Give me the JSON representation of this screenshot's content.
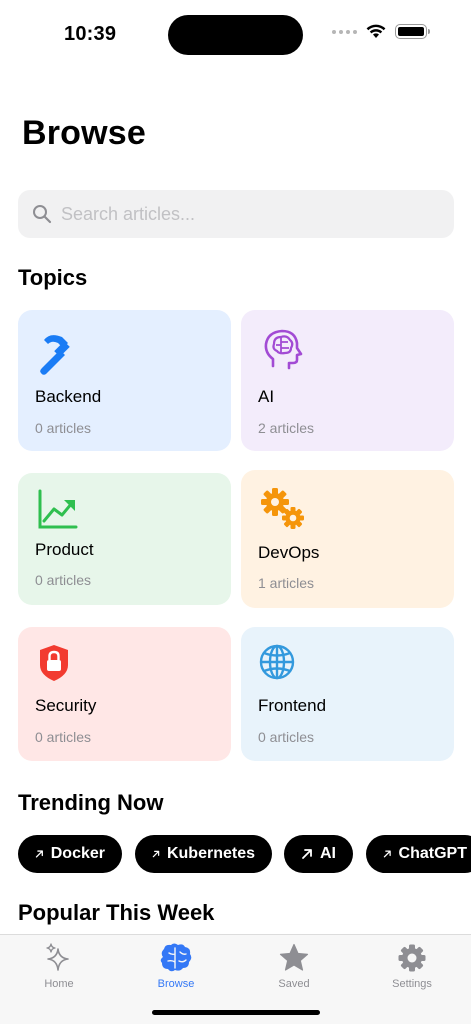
{
  "status_bar": {
    "time": "10:39"
  },
  "header": {
    "title": "Browse"
  },
  "search": {
    "placeholder": "Search articles..."
  },
  "topics": {
    "title": "Topics",
    "items": [
      {
        "name": "Backend",
        "count": "0 articles",
        "icon": "hammer-icon",
        "color": "#e4efff",
        "icon_color": "#1a7cf5"
      },
      {
        "name": "AI",
        "count": "2 articles",
        "icon": "brain-head-icon",
        "color": "#f3ecfb",
        "icon_color": "#a24bd4"
      },
      {
        "name": "Product",
        "count": "0 articles",
        "icon": "chart-line-uptrend-icon",
        "color": "#e7f6ea",
        "icon_color": "#2fbf4f"
      },
      {
        "name": "DevOps",
        "count": "1 articles",
        "icon": "gears-icon",
        "color": "#fff2e2",
        "icon_color": "#f5950a"
      },
      {
        "name": "Security",
        "count": "0 articles",
        "icon": "lock-shield-icon",
        "color": "#ffe7e6",
        "icon_color": "#f23b30"
      },
      {
        "name": "Frontend",
        "count": "0 articles",
        "icon": "globe-icon",
        "color": "#e8f3fb",
        "icon_color": "#3399dd"
      }
    ]
  },
  "trending": {
    "title": "Trending Now",
    "chips": [
      "Docker",
      "Kubernetes",
      "AI",
      "ChatGPT"
    ]
  },
  "popular": {
    "title": "Popular This Week"
  },
  "tab_bar": {
    "active_color": "#3478f6",
    "tabs": [
      {
        "label": "Home",
        "icon": "sparkles-icon"
      },
      {
        "label": "Browse",
        "icon": "brain-icon",
        "active": true
      },
      {
        "label": "Saved",
        "icon": "star-icon"
      },
      {
        "label": "Settings",
        "icon": "gear-icon"
      }
    ]
  }
}
